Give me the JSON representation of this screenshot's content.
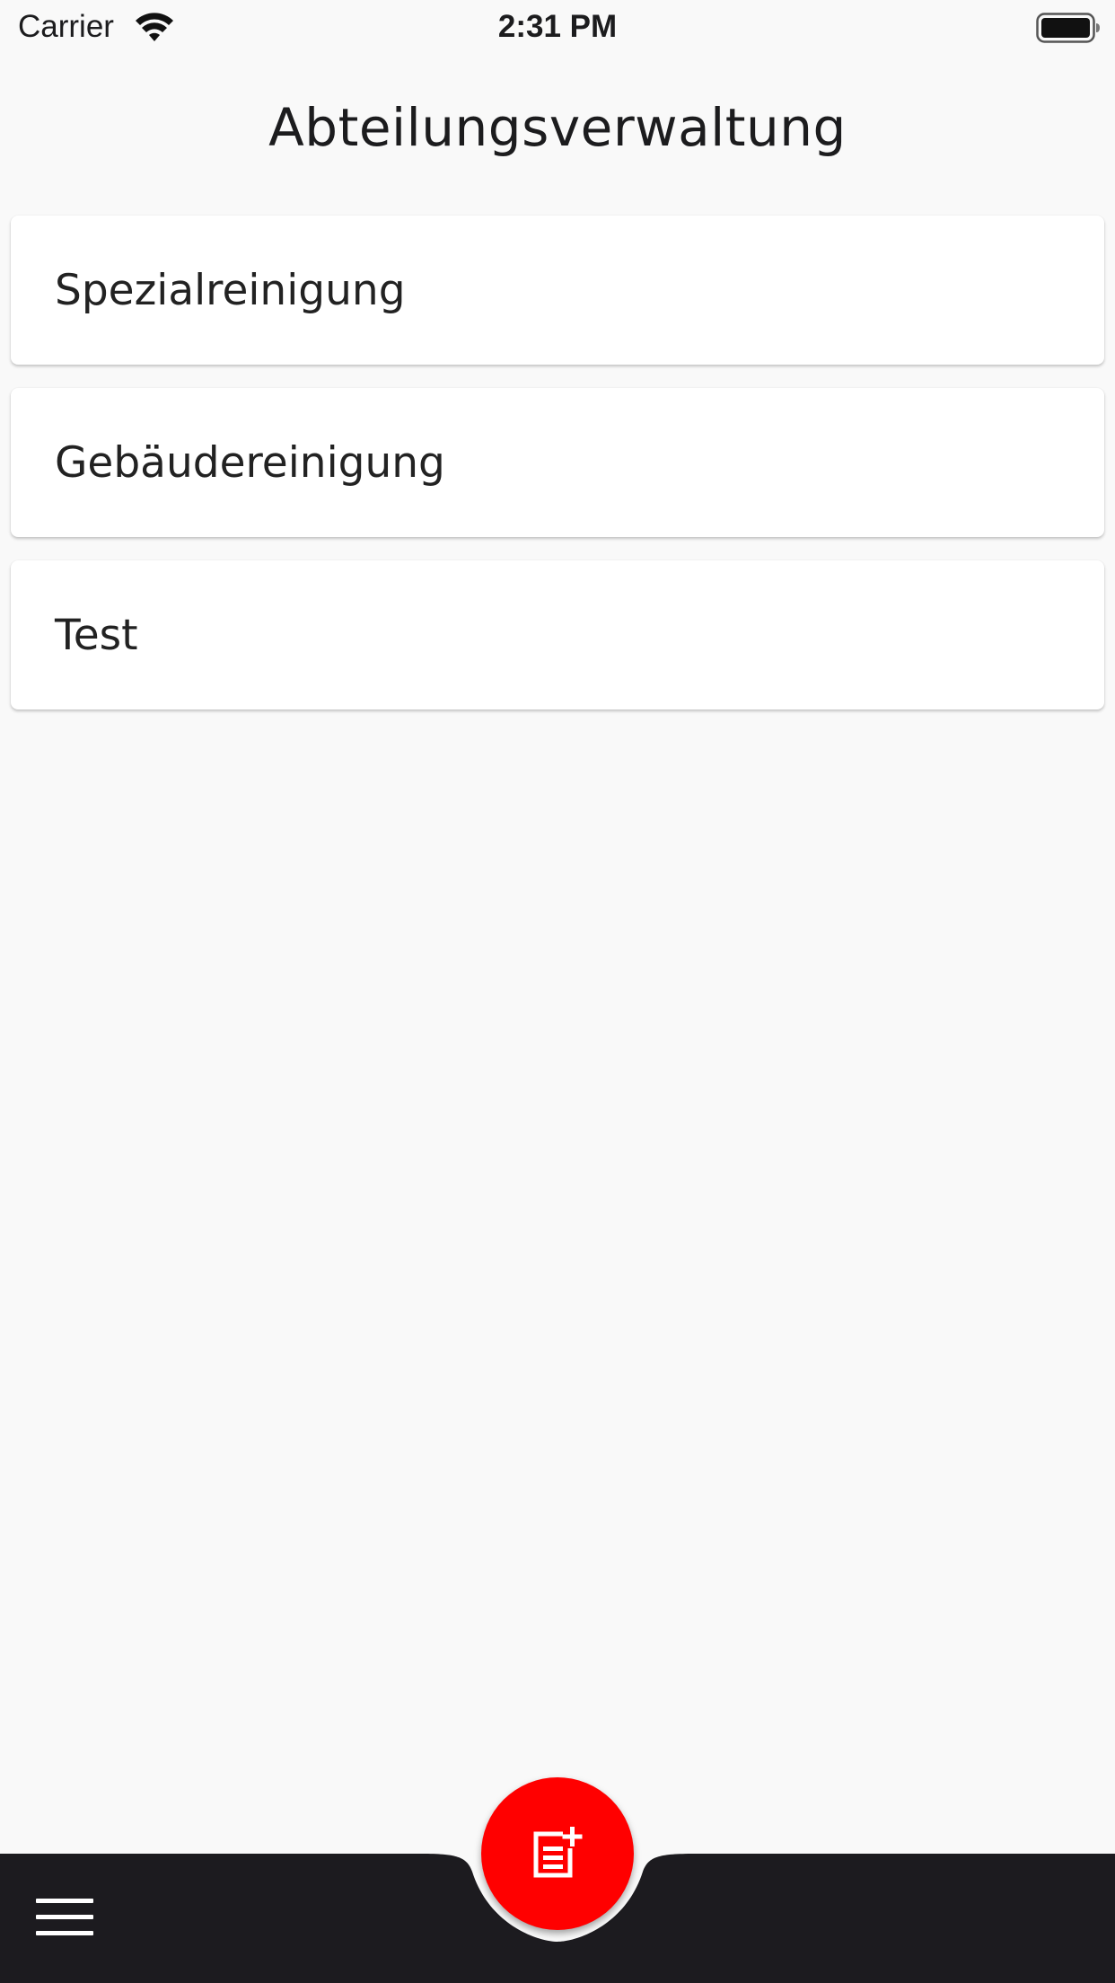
{
  "status_bar": {
    "carrier": "Carrier",
    "time": "2:31 PM",
    "wifi_icon": "wifi-icon",
    "battery_icon": "battery-full-icon"
  },
  "header": {
    "title": "Abteilungsverwaltung"
  },
  "list": {
    "items": [
      {
        "label": "Spezialreinigung"
      },
      {
        "label": "Gebäudereinigung"
      },
      {
        "label": "Test"
      }
    ]
  },
  "bottom_bar": {
    "menu_icon": "menu-icon",
    "background_color": "#1c1b1f"
  },
  "fab": {
    "icon": "post-add-icon",
    "color": "#ff0000"
  }
}
